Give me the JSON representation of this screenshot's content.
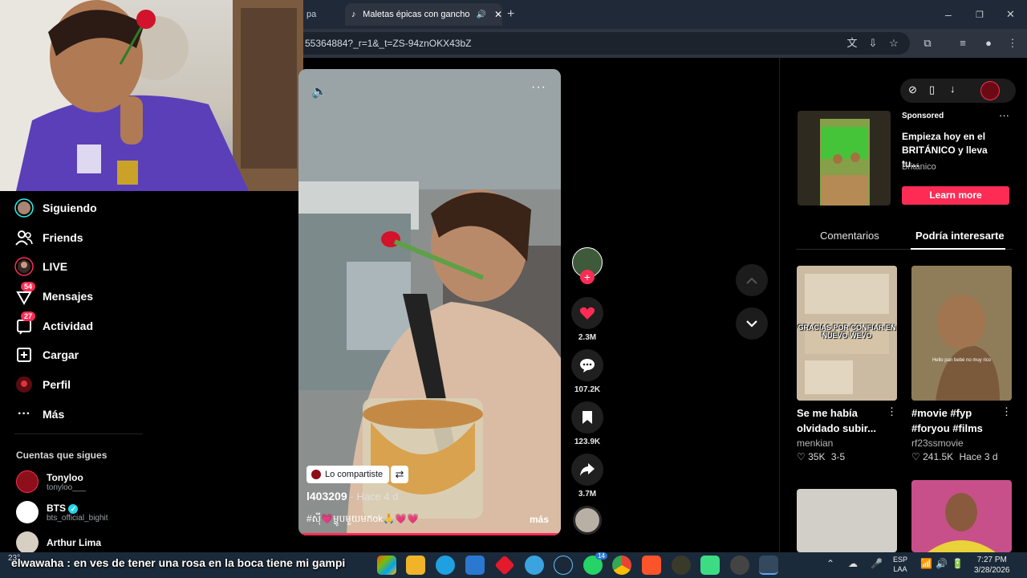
{
  "browser": {
    "tab_prev_label": "pa",
    "tab_active_label": "Maletas épicas con gancho",
    "url": "55364884?_r=1&_t=ZS-94znOKX43bZ"
  },
  "nav": {
    "items": [
      {
        "label": "Siguiendo"
      },
      {
        "label": "Friends"
      },
      {
        "label": "LIVE"
      },
      {
        "label": "Mensajes",
        "badge": "54"
      },
      {
        "label": "Actividad",
        "badge": "27"
      },
      {
        "label": "Cargar"
      },
      {
        "label": "Perfil"
      },
      {
        "label": "Más"
      }
    ],
    "following_heading": "Cuentas que sigues",
    "accounts": [
      {
        "name": "Tonyloo",
        "handle": "tonyloo___"
      },
      {
        "name": "BTS",
        "handle": "bts_official_bighit"
      },
      {
        "name": "Arthur Lima",
        "handle": ""
      }
    ]
  },
  "video": {
    "shared_label": "Lo compartiste",
    "author": "l403209",
    "time": "· Hace 4 d",
    "caption": "#ស៊ី💗ម្ហូបមួយមកok🙏💗💗",
    "more": "más",
    "progress_fraction": 1.0
  },
  "actions": {
    "likes": "2.3M",
    "comments": "107.2K",
    "saves": "123.9K",
    "shares": "3.7M"
  },
  "ad": {
    "sponsored": "Sponsored",
    "title": "Empieza hoy en el BRITÁNICO y lleva tu...",
    "brand": "Británico",
    "cta": "Learn more"
  },
  "tabs": {
    "comments": "Comentarios",
    "suggested": "Podría interesarte"
  },
  "cards": [
    {
      "overlay": "GRACIAS POR CONFIAR EN NUEVO WEVO",
      "title": "Se me había olvidado subir...",
      "user": "menkian",
      "likes": "35K",
      "date": "3-5"
    },
    {
      "overlay": "Hello pan bebé no muy rico",
      "title": "#movie #fyp #foryou #films",
      "user": "rf23ssmovie",
      "likes": "241.5K",
      "date": "Hace 3 d"
    }
  ],
  "taskbar": {
    "subtitle": "elwawaha : en ves de tener una rosa en la boca tiene mi gampi",
    "temp": "23°",
    "lang1": "ESP",
    "lang2": "LAA",
    "time": "7:27 PM",
    "date": "3/28/2026",
    "badge_whatsapp": "14"
  },
  "colors": {
    "accent": "#fe2c55",
    "taskbar": "#1b2a3a",
    "chrome": "#2e3440"
  }
}
